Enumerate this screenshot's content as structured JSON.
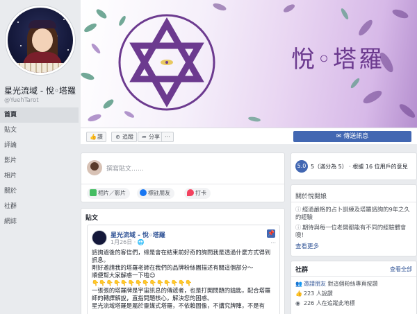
{
  "page": {
    "name": "星光流域 - 悅◦塔羅",
    "handle": "@YuehTarot"
  },
  "nav": [
    {
      "label": "首頁",
      "active": true
    },
    {
      "label": "貼文"
    },
    {
      "label": "評論"
    },
    {
      "label": "影片"
    },
    {
      "label": "相片"
    },
    {
      "label": "關於"
    },
    {
      "label": "社群"
    },
    {
      "label": "網誌"
    }
  ],
  "cover": {
    "title": "悅◦塔羅",
    "brand_color": "#6c3a8f"
  },
  "actions": {
    "like": "讚",
    "follow": "追蹤",
    "share": "分享",
    "more": "···",
    "send_message": "傳送訊息"
  },
  "composer": {
    "placeholder": "撰寫貼文……",
    "photo_video": "相片／影片",
    "tag_friends": "標註朋友",
    "check_in": "打卡"
  },
  "posts": {
    "heading": "貼文",
    "items": [
      {
        "author": "星光流域 - 悅◦塔羅",
        "date": "1月26日 · 🌐",
        "more": "···",
        "body": [
          "諮詢過後的客信們，總是會在結束前好奇的詢問我是透過什麼方式得到訊息。",
          "剛好邀請我的塔羅老師在我們的品牌粉絲團描述有關這個部分～",
          "順便幫大家解惑一下啦😊",
          "👇👇👇👇👇👇👇👇👇👇👇👇👇👇",
          "一張張的塔羅牌是宇宙訊息的傳遞者，也是打開問題的鑰匙，配合塔羅師的轉譯解說，直指問題核心，解決您的困惑。",
          "星光流域塔羅是屬於靈媒式塔羅，不依賴圖像，不講究牌陣，不是有"
        ]
      }
    ]
  },
  "rating": {
    "score": "5.0",
    "text": "5（滿分為 5） · 根據 16 位用戶的意見"
  },
  "about": {
    "heading": "關於悅閱娘",
    "rows": [
      "經過嚴格的占卜訓練及塔羅諮詢的9年之久的經驗",
      "期待與每一位老闆都能有不同的經驗體會噢！"
    ],
    "see_more": "查看更多"
  },
  "community": {
    "heading": "社群",
    "see_all": "查看全部",
    "invite": "邀請朋友",
    "invite_suffix": "對這個粉絲專頁按讚",
    "likes": "223 人說讚",
    "following": "226 人在追蹤此地標"
  }
}
